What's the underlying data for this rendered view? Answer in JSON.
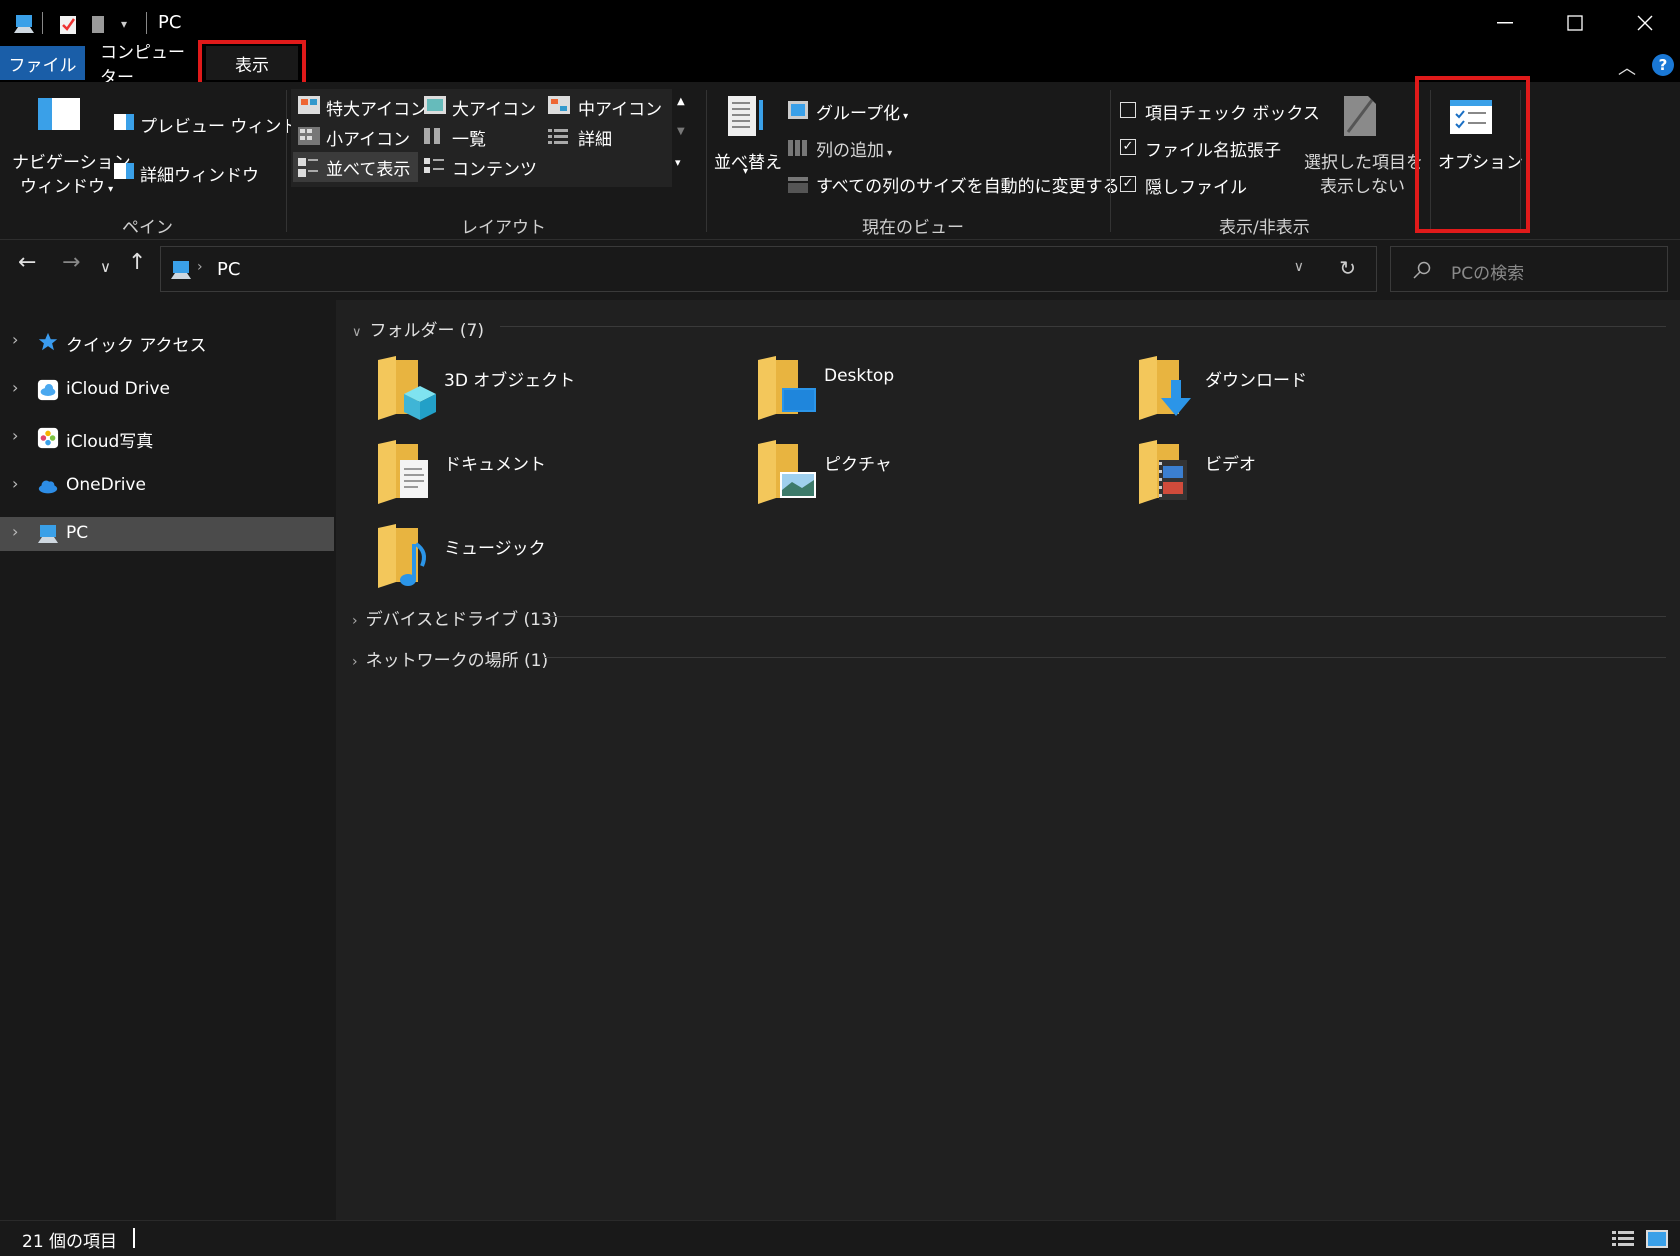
{
  "window": {
    "title": "PC",
    "minimize": "—",
    "maximize": "☐",
    "close": "✕"
  },
  "tabs": {
    "file": "ファイル",
    "computer": "コンピューター",
    "view": "表示"
  },
  "ribbon": {
    "panes": {
      "navigation": [
        "ナビゲーション",
        "ウィンドウ"
      ],
      "preview": "プレビュー ウィンドウ",
      "details": "詳細ウィンドウ",
      "group_label": "ペイン"
    },
    "layout": {
      "extra_large": "特大アイコン",
      "large": "大アイコン",
      "medium": "中アイコン",
      "small": "小アイコン",
      "list": "一覧",
      "details": "詳細",
      "tiles": "並べて表示",
      "content": "コンテンツ",
      "group_label": "レイアウト"
    },
    "current_view": {
      "sort": "並べ替え",
      "group_by": "グループ化",
      "add_columns": "列の追加",
      "size_all": "すべての列のサイズを自動的に変更する",
      "group_label": "現在のビュー"
    },
    "show_hide": {
      "item_checkboxes": {
        "label": "項目チェック ボックス",
        "checked": false
      },
      "extensions": {
        "label": "ファイル名拡張子",
        "checked": true
      },
      "hidden_items": {
        "label": "隠しファイル",
        "checked": true
      },
      "hide_selected": [
        "選択した項目を",
        "表示しない"
      ],
      "group_label": "表示/非表示"
    },
    "options": "オプション"
  },
  "address": {
    "path": "PC",
    "search_placeholder": "PCの検索"
  },
  "sidebar": {
    "items": [
      {
        "label": "クイック アクセス",
        "icon": "star-icon"
      },
      {
        "label": "iCloud Drive",
        "icon": "icloud-icon"
      },
      {
        "label": "iCloud写真",
        "icon": "photos-icon"
      },
      {
        "label": "OneDrive",
        "icon": "onedrive-icon"
      },
      {
        "label": "PC",
        "icon": "pc-icon",
        "selected": true
      }
    ]
  },
  "content": {
    "folders_header": "フォルダー (7)",
    "folders": [
      {
        "label": "3D オブジェクト",
        "icon": "3d-objects-folder-icon"
      },
      {
        "label": "Desktop",
        "icon": "desktop-folder-icon"
      },
      {
        "label": "ダウンロード",
        "icon": "downloads-folder-icon"
      },
      {
        "label": "ドキュメント",
        "icon": "documents-folder-icon"
      },
      {
        "label": "ピクチャ",
        "icon": "pictures-folder-icon"
      },
      {
        "label": "ビデオ",
        "icon": "videos-folder-icon"
      },
      {
        "label": "ミュージック",
        "icon": "music-folder-icon"
      }
    ],
    "devices_header": "デバイスとドライブ (13)",
    "network_header": "ネットワークの場所 (1)"
  },
  "status": {
    "count": "21 個の項目"
  },
  "colors": {
    "accent": "#1a5ea8",
    "highlight": "#e01a1a",
    "folder": "#f3c75b"
  }
}
